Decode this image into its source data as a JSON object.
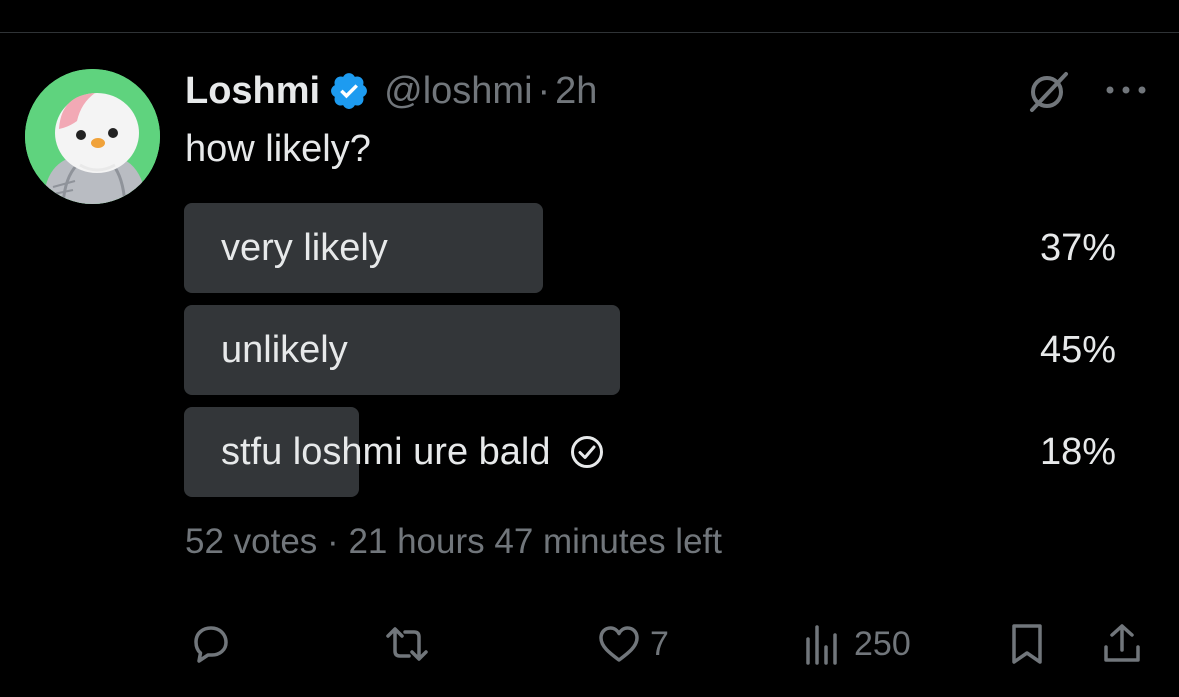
{
  "tweet": {
    "author_name": "Loshmi",
    "handle": "@loshmi",
    "separator": "·",
    "time": "2h",
    "text": "how likely?"
  },
  "poll": {
    "options": [
      {
        "label": "very likely",
        "percent_label": "37%",
        "fill_fraction": 0.385,
        "voted": false
      },
      {
        "label": "unlikely",
        "percent_label": "45%",
        "fill_fraction": 0.468,
        "voted": false
      },
      {
        "label": "stfu loshmi ure bald",
        "percent_label": "18%",
        "fill_fraction": 0.188,
        "voted": true
      }
    ],
    "votes_text": "52 votes",
    "separator": "·",
    "time_left": "21 hours 47 minutes left"
  },
  "actions": {
    "reply_count": "",
    "retweet_count": "",
    "like_count": "7",
    "views_count": "250"
  },
  "icons": [
    "verified-badge-icon",
    "grok-icon",
    "more-icon",
    "check-circle-icon",
    "reply-icon",
    "retweet-icon",
    "like-icon",
    "views-icon",
    "bookmark-icon",
    "share-icon"
  ],
  "colors": {
    "background": "#000000",
    "text": "#e7e9ea",
    "secondary_text": "#71767b",
    "poll_bar": "#333639",
    "verified_blue": "#1d9bf0",
    "avatar_bg": "#5fd37e"
  }
}
